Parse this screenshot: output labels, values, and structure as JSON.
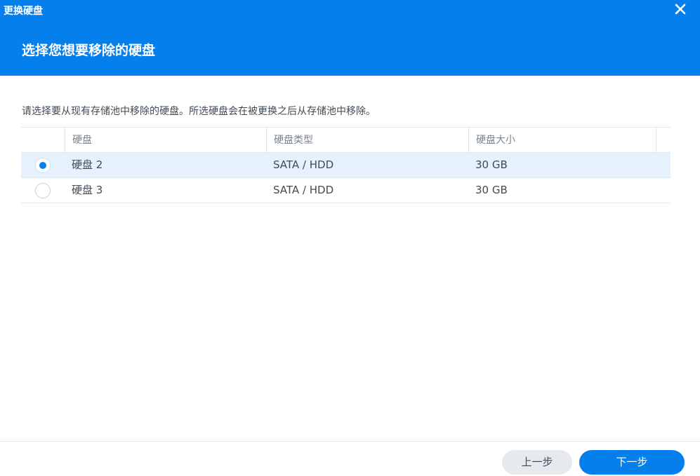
{
  "window": {
    "title": "更换硬盘"
  },
  "header": {
    "step_title": "选择您想要移除的硬盘"
  },
  "main": {
    "description": "请选择要从现有存储池中移除的硬盘。所选硬盘会在被更换之后从存储池中移除。",
    "columns": [
      "硬盘",
      "硬盘类型",
      "硬盘大小"
    ],
    "rows": [
      {
        "disk": "硬盘 2",
        "type": "SATA / HDD",
        "size": "30 GB",
        "selected": true
      },
      {
        "disk": "硬盘 3",
        "type": "SATA / HDD",
        "size": "30 GB",
        "selected": false
      }
    ]
  },
  "footer": {
    "back_label": "上一步",
    "next_label": "下一步"
  },
  "colors": {
    "accent": "#057feb",
    "selected_row": "#e5f1fd"
  },
  "icons": {
    "close": "close-icon",
    "radio_checked": "radio-checked-icon",
    "radio_unchecked": "radio-unchecked-icon"
  }
}
